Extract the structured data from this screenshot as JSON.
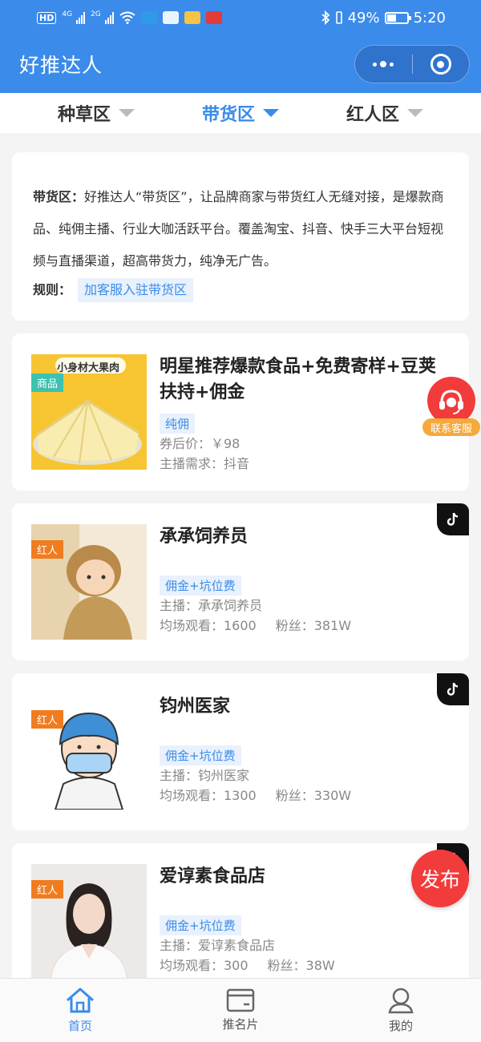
{
  "status_bar": {
    "network_4g": "4G",
    "network_2g": "2G",
    "hd_label": "HD",
    "battery": "49%",
    "time": "5:20"
  },
  "header": {
    "title": "好推达人"
  },
  "tabs": [
    {
      "label": "种草区",
      "active": false
    },
    {
      "label": "带货区",
      "active": true
    },
    {
      "label": "红人区",
      "active": false
    }
  ],
  "intro": {
    "label": "带货区：",
    "text": "好推达人“带货区”，让品牌商家与带货红人无缝对接，是爆款商品、纯佣主播、行业大咖活跃平台。覆盖淘宝、抖音、快手三大平台短视频与直播渠道，超高带货力，纯净无广告。",
    "rule_label": "规则：",
    "rule_link": "加客服入驻带货区"
  },
  "items": [
    {
      "badge": "商品",
      "title": "明星推荐爆款食品+免费寄样+豆荚扶持+佣金",
      "tag": "纯佣",
      "line1": "券后价：￥98",
      "line2": "主播需求：抖音",
      "thumb_text": "小身材大果肉"
    },
    {
      "badge": "红人",
      "title": "承承饲养员",
      "tag": "佣金+坑位费",
      "line1": "主播：承承饲养员",
      "views": "均场观看：1600",
      "fans": "粉丝：381W"
    },
    {
      "badge": "红人",
      "title": "钧州医家",
      "tag": "佣金+坑位费",
      "line1": "主播：钧州医家",
      "views": "均场观看：1300",
      "fans": "粉丝：330W"
    },
    {
      "badge": "红人",
      "title": "爱谆素食品店",
      "tag": "佣金+坑位费",
      "line1": "主播：爱谆素食品店",
      "views": "均场观看：300",
      "fans": "粉丝：38W"
    }
  ],
  "floating": {
    "customer_service": "联系客服",
    "publish": "发布"
  },
  "bottom_nav": [
    {
      "label": "首页",
      "active": true
    },
    {
      "label": "推名片",
      "active": false
    },
    {
      "label": "我的",
      "active": false
    }
  ],
  "colors": {
    "primary": "#3b8bea",
    "accent_red": "#f23b3b",
    "badge_orange": "#f07c1f",
    "badge_teal": "#3ec1b0"
  }
}
